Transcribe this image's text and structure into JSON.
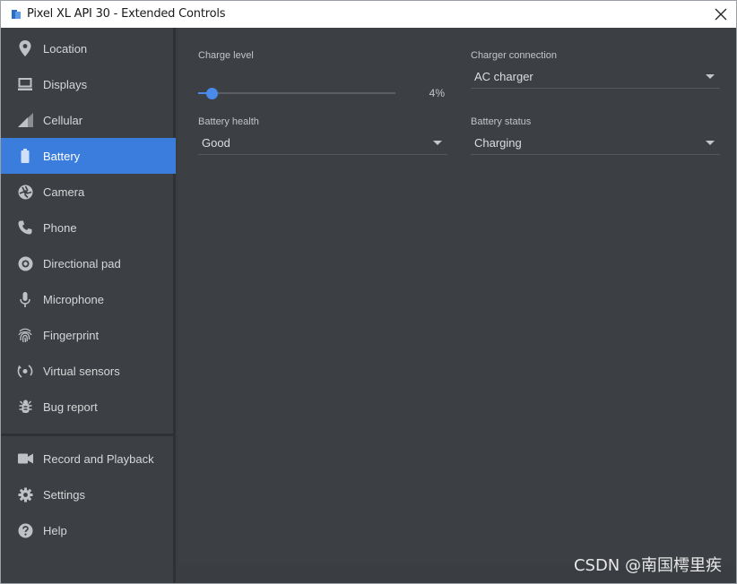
{
  "window": {
    "title": "Pixel XL API 30 - Extended Controls"
  },
  "sidebar": {
    "items": [
      {
        "label": "Location",
        "icon": "location-pin-icon"
      },
      {
        "label": "Displays",
        "icon": "display-icon"
      },
      {
        "label": "Cellular",
        "icon": "signal-icon"
      },
      {
        "label": "Battery",
        "icon": "battery-icon",
        "active": true
      },
      {
        "label": "Camera",
        "icon": "camera-aperture-icon"
      },
      {
        "label": "Phone",
        "icon": "phone-icon"
      },
      {
        "label": "Directional pad",
        "icon": "dpad-icon"
      },
      {
        "label": "Microphone",
        "icon": "microphone-icon"
      },
      {
        "label": "Fingerprint",
        "icon": "fingerprint-icon"
      },
      {
        "label": "Virtual sensors",
        "icon": "rotate-sensor-icon"
      },
      {
        "label": "Bug report",
        "icon": "bug-icon"
      }
    ],
    "bottom_items": [
      {
        "label": "Record and Playback",
        "icon": "video-camera-icon"
      },
      {
        "label": "Settings",
        "icon": "gear-icon"
      },
      {
        "label": "Help",
        "icon": "help-icon"
      }
    ]
  },
  "battery": {
    "charge_level_label": "Charge level",
    "charge_level_value": 4,
    "charge_level_text": "4%",
    "charger_connection_label": "Charger connection",
    "charger_connection_value": "AC charger",
    "battery_health_label": "Battery health",
    "battery_health_value": "Good",
    "battery_status_label": "Battery status",
    "battery_status_value": "Charging"
  },
  "watermark": "CSDN @南国樗里疾",
  "colors": {
    "accent": "#3b7ddd",
    "panel": "#3c3f43"
  }
}
